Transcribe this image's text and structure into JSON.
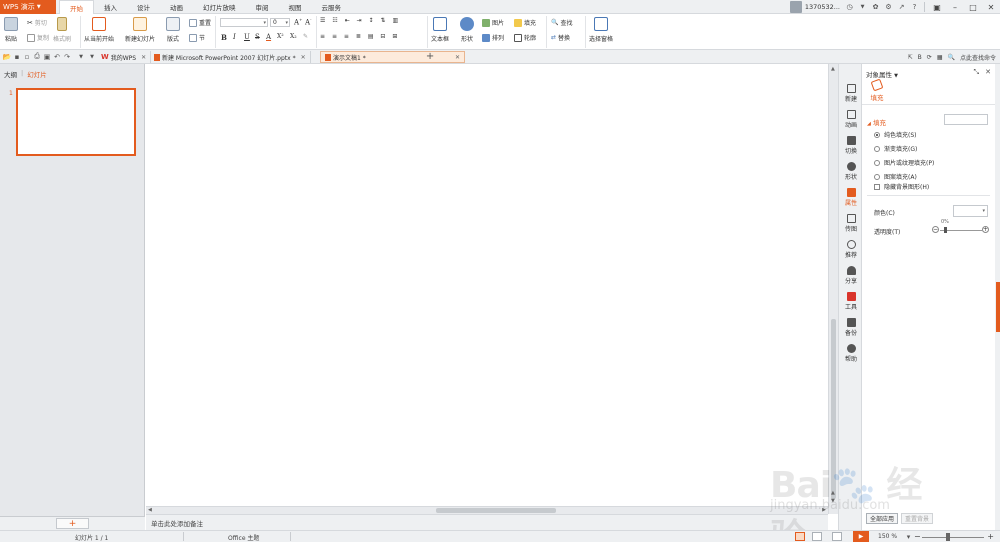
{
  "app": {
    "button_label": "WPS 演示",
    "accent": "#e35b1e"
  },
  "menu_tabs": [
    {
      "label": "开始",
      "active": true
    },
    {
      "label": "插入"
    },
    {
      "label": "设计"
    },
    {
      "label": "动画"
    },
    {
      "label": "幻灯片放映"
    },
    {
      "label": "审阅"
    },
    {
      "label": "视图"
    },
    {
      "label": "云服务"
    }
  ],
  "user": {
    "name": "1370532..."
  },
  "ribbon": {
    "paste": "粘贴",
    "cut": "剪切",
    "copy": "复制",
    "format_painter": "格式刷",
    "from_current": "从当前开始",
    "new_slide": "新建幻灯片",
    "layout": "版式",
    "section": "节",
    "reset": "重置",
    "font_size": "0",
    "bold": "B",
    "italic": "I",
    "underline": "U",
    "strike": "S",
    "shadow": "A",
    "superscript": "X²",
    "subscript": "X₂",
    "textbox": "文本框",
    "shapes": "形状",
    "picture": "图片",
    "fill": "填充",
    "arrange": "排列",
    "outline": "轮廓",
    "find": "查找",
    "replace": "替换",
    "select_pane": "选择窗格"
  },
  "doc_tabs": [
    {
      "label": "我的WPS"
    },
    {
      "label": "新建 Microsoft PowerPoint 2007 幻灯片.pptx *"
    },
    {
      "label": "演示文稿1 *",
      "active": true
    }
  ],
  "tab_right": {
    "command_search": "点此查找命令"
  },
  "left_pane": {
    "tab_outline": "大纲",
    "tab_slides": "幻灯片",
    "slide_number": "1",
    "add_label": "+"
  },
  "notes_placeholder": "单击此处添加备注",
  "side_toolbar": [
    {
      "label": "新建",
      "icon": "new-icon"
    },
    {
      "label": "动画",
      "icon": "animation-icon"
    },
    {
      "label": "切换",
      "icon": "transition-icon"
    },
    {
      "label": "形状",
      "icon": "shape-icon"
    },
    {
      "label": "属性",
      "icon": "properties-icon",
      "active": true
    },
    {
      "label": "传图",
      "icon": "upload-image-icon"
    },
    {
      "label": "推荐",
      "icon": "recommend-icon"
    },
    {
      "label": "分享",
      "icon": "share-icon"
    },
    {
      "label": "工具",
      "icon": "toolbox-icon"
    },
    {
      "label": "备份",
      "icon": "backup-icon"
    },
    {
      "label": "帮助",
      "icon": "help-icon"
    }
  ],
  "props": {
    "title": "对象属性",
    "fill_tab": "填充",
    "section_fill": "填充",
    "options": [
      {
        "label": "纯色填充(S)",
        "checked": true
      },
      {
        "label": "渐变填充(G)"
      },
      {
        "label": "图片或纹理填充(P)"
      },
      {
        "label": "图案填充(A)"
      }
    ],
    "hide_bg": "隐藏背景图形(H)",
    "color_label": "颜色(C)",
    "transparency_label": "透明度(T)",
    "transparency_value": "0%",
    "apply_all": "全部应用",
    "reset_bg": "重置背景"
  },
  "watermark": {
    "logo": "Bai🐾 经验",
    "url": "jingyan.baidu.com"
  },
  "status": {
    "slide_counter": "幻灯片 1 / 1",
    "theme": "Office 主题",
    "zoom": "150 %"
  }
}
